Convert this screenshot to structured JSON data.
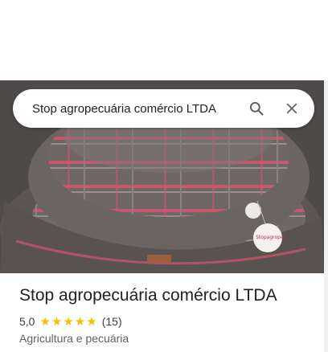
{
  "search": {
    "query": "Stop agropecuária comércio LTDA"
  },
  "place": {
    "name": "Stop agropecuária comércio LTDA",
    "rating": "5,0",
    "stars_filled": 5,
    "reviews": "(15)",
    "category": "Agricultura e pecuária"
  },
  "photo": {
    "tag_text": "Stopagropec"
  },
  "colors": {
    "star": "#fbbc04",
    "accent_pink": "#d9536f",
    "fabric": "#6b6563"
  },
  "icons": [
    "search-icon",
    "close-icon",
    "star-icon"
  ]
}
